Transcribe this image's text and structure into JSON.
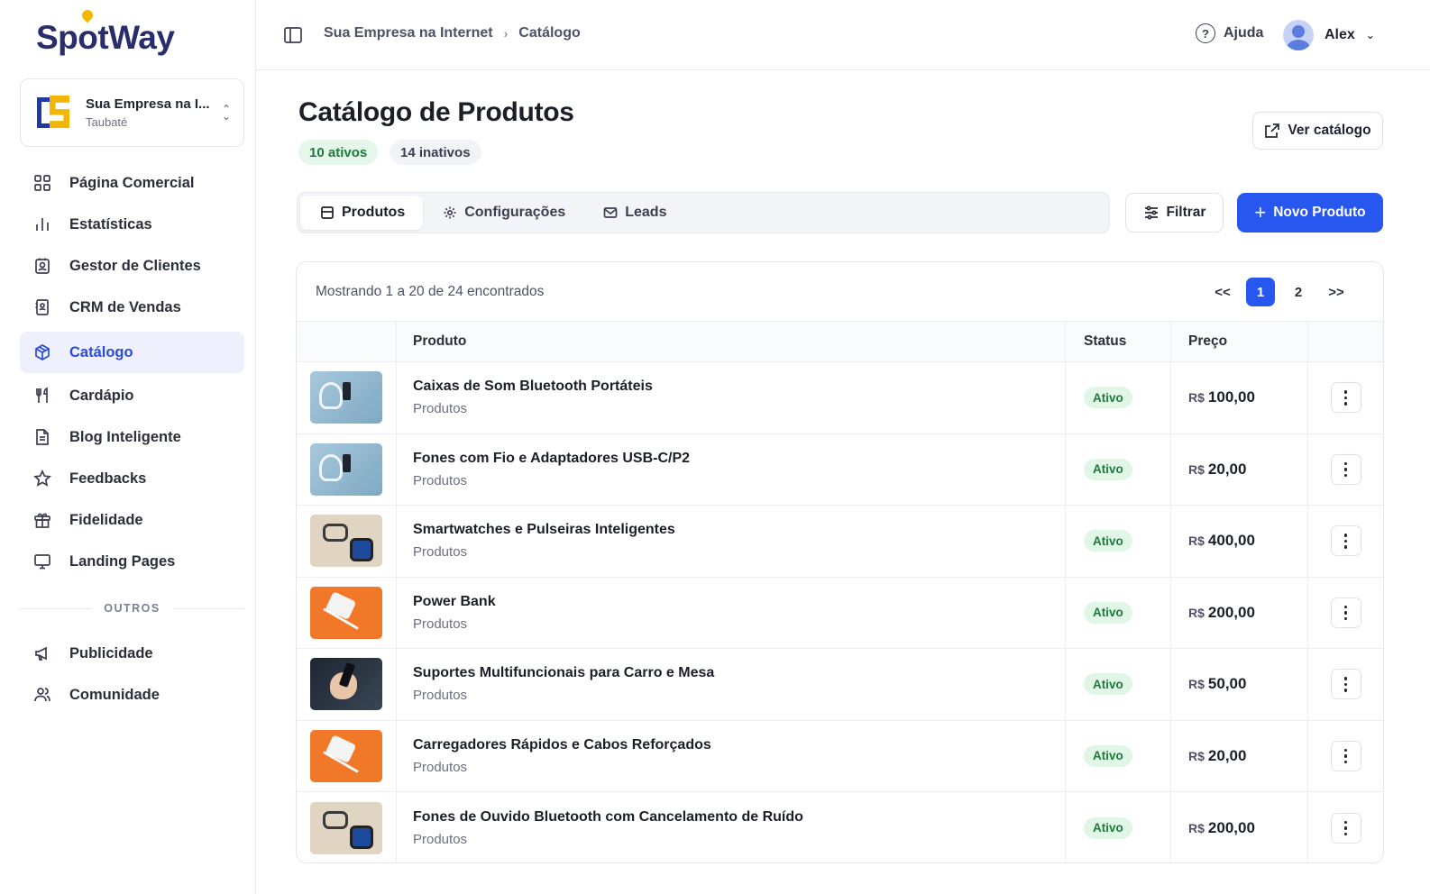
{
  "brand": {
    "part1": "Sp",
    "part2": "o",
    "part3": "tWay"
  },
  "company": {
    "name": "Sua Empresa na I...",
    "city": "Taubaté"
  },
  "sidebar": {
    "items": [
      {
        "label": "Página Comercial",
        "icon": "grid-icon"
      },
      {
        "label": "Estatísticas",
        "icon": "bar-chart-icon"
      },
      {
        "label": "Gestor de Clientes",
        "icon": "contact-card-icon"
      },
      {
        "label": "CRM de Vendas",
        "icon": "contact-book-icon"
      },
      {
        "label": "Catálogo",
        "icon": "package-icon",
        "active": true
      },
      {
        "label": "Cardápio",
        "icon": "utensils-icon"
      },
      {
        "label": "Blog Inteligente",
        "icon": "file-text-icon"
      },
      {
        "label": "Feedbacks",
        "icon": "star-icon"
      },
      {
        "label": "Fidelidade",
        "icon": "gift-icon"
      },
      {
        "label": "Landing Pages",
        "icon": "monitor-icon"
      }
    ],
    "others_label": "OUTROS",
    "others": [
      {
        "label": "Publicidade",
        "icon": "megaphone-icon"
      },
      {
        "label": "Comunidade",
        "icon": "users-icon"
      }
    ]
  },
  "header": {
    "breadcrumb": [
      "Sua Empresa na Internet",
      "Catálogo"
    ],
    "help_label": "Ajuda",
    "user_name": "Alex"
  },
  "page": {
    "title": "Catálogo de Produtos",
    "active_count": "10 ativos",
    "inactive_count": "14 inativos",
    "view_catalog_label": "Ver catálogo",
    "filter_label": "Filtrar",
    "new_product_label": "Novo Produto"
  },
  "tabs": [
    {
      "label": "Produtos",
      "icon": "store-icon",
      "active": true
    },
    {
      "label": "Configurações",
      "icon": "gear-icon"
    },
    {
      "label": "Leads",
      "icon": "mail-icon"
    }
  ],
  "table": {
    "showing": "Mostrando 1 a 20 de 24 encontrados",
    "pager": {
      "first": "<<",
      "pages": [
        "1",
        "2"
      ],
      "current": "1",
      "last": ">>"
    },
    "headers": {
      "product": "Produto",
      "status": "Status",
      "price": "Preço"
    },
    "currency": "R$",
    "rows": [
      {
        "name": "Caixas de Som Bluetooth Portáteis",
        "category": "Produtos",
        "status": "Ativo",
        "price": "100,00",
        "thumb": "blue"
      },
      {
        "name": "Fones com Fio e Adaptadores USB-C/P2",
        "category": "Produtos",
        "status": "Ativo",
        "price": "20,00",
        "thumb": "blue"
      },
      {
        "name": "Smartwatches e Pulseiras Inteligentes",
        "category": "Produtos",
        "status": "Ativo",
        "price": "400,00",
        "thumb": "beige"
      },
      {
        "name": "Power Bank",
        "category": "Produtos",
        "status": "Ativo",
        "price": "200,00",
        "thumb": "orange"
      },
      {
        "name": "Suportes Multifuncionais para Carro e Mesa",
        "category": "Produtos",
        "status": "Ativo",
        "price": "50,00",
        "thumb": "dark"
      },
      {
        "name": "Carregadores Rápidos e Cabos Reforçados",
        "category": "Produtos",
        "status": "Ativo",
        "price": "20,00",
        "thumb": "orange"
      },
      {
        "name": "Fones de Ouvido Bluetooth com Cancelamento de Ruído",
        "category": "Produtos",
        "status": "Ativo",
        "price": "200,00",
        "thumb": "beige"
      }
    ]
  },
  "colors": {
    "accent": "#2757ee",
    "brand": "#2a2d6b",
    "brand_yellow": "#f5b800",
    "active_green": "#1d7a3c"
  }
}
